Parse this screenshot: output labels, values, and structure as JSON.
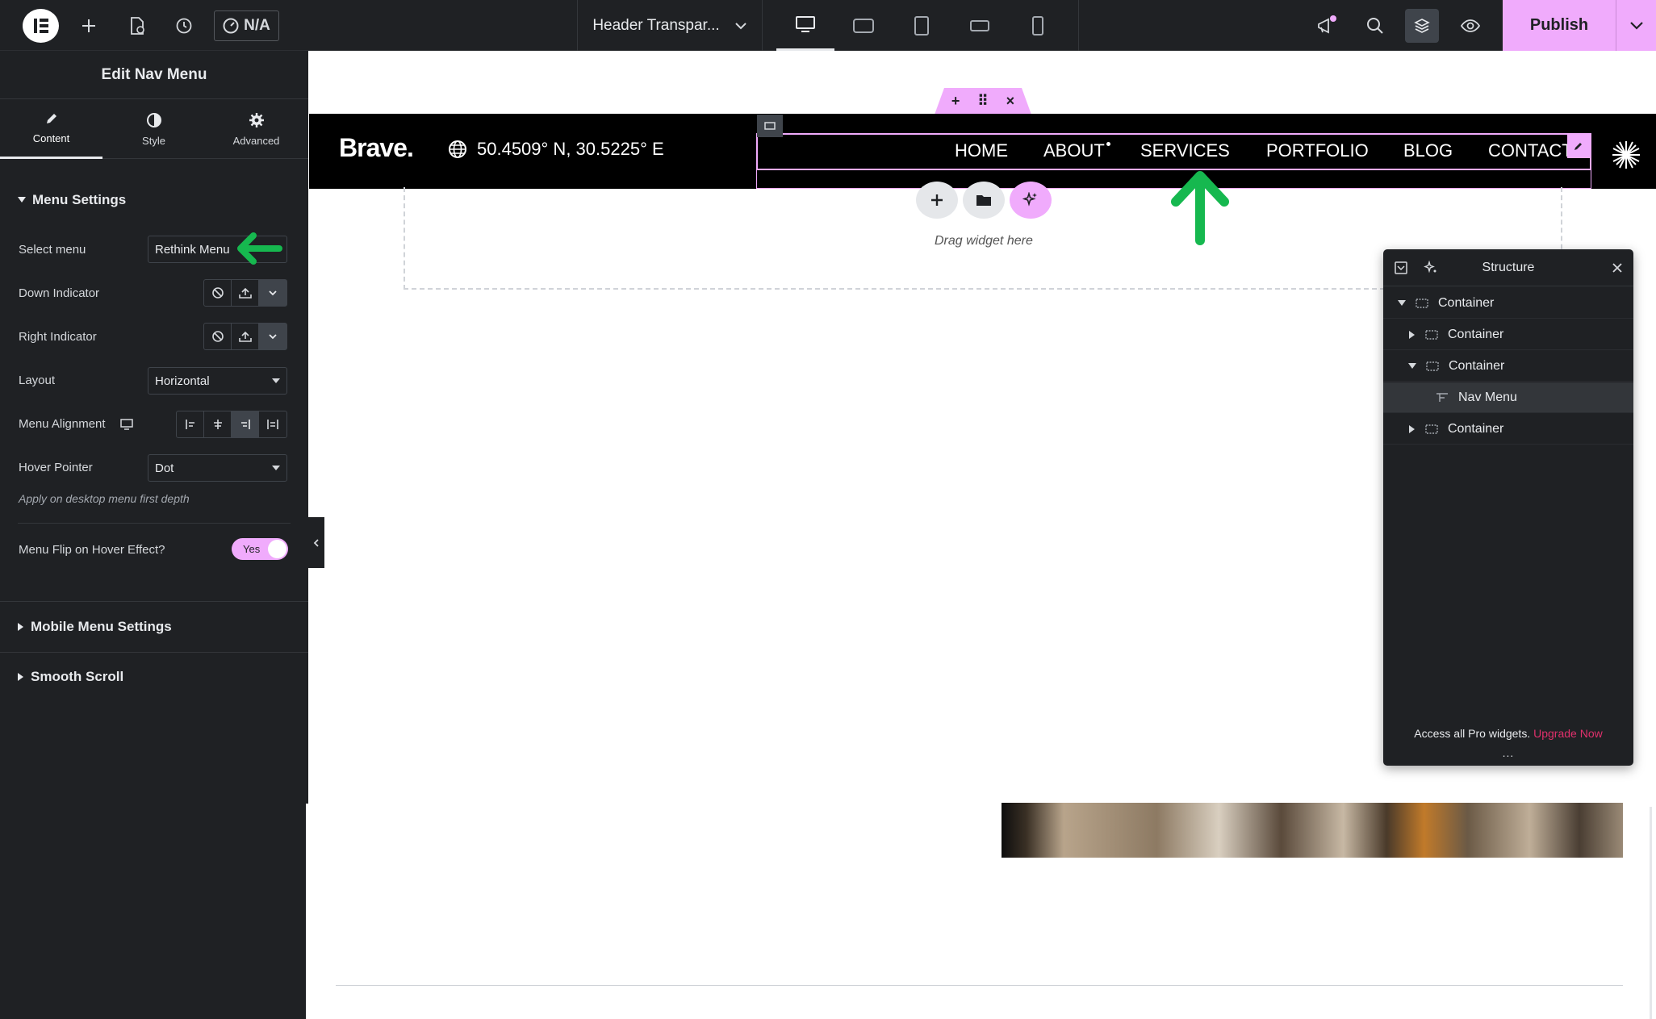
{
  "topbar": {
    "na_label": "N/A",
    "document_title": "Header Transpar...",
    "publish_label": "Publish"
  },
  "panel": {
    "title": "Edit Nav Menu",
    "tabs": [
      "Content",
      "Style",
      "Advanced"
    ],
    "menu_settings": {
      "heading": "Menu Settings",
      "select_menu_label": "Select menu",
      "select_menu_value": "Rethink Menu",
      "down_indicator_label": "Down Indicator",
      "right_indicator_label": "Right Indicator",
      "layout_label": "Layout",
      "layout_value": "Horizontal",
      "alignment_label": "Menu Alignment",
      "hover_pointer_label": "Hover Pointer",
      "hover_pointer_value": "Dot",
      "hint": "Apply on desktop menu first depth",
      "flip_label": "Menu Flip on Hover Effect?",
      "flip_value": "Yes"
    },
    "mobile_heading": "Mobile Menu Settings",
    "smooth_heading": "Smooth Scroll"
  },
  "canvas": {
    "brand": "Brave.",
    "coords": "50.4509° N, 30.5225° E",
    "nav_items": [
      "HOME",
      "ABOUT",
      "SERVICES",
      "PORTFOLIO",
      "BLOG",
      "CONTACT"
    ],
    "drop_text": "Drag widget here"
  },
  "structure": {
    "title": "Structure",
    "rows": [
      {
        "label": "Container"
      },
      {
        "label": "Container"
      },
      {
        "label": "Container"
      },
      {
        "label": "Nav Menu"
      },
      {
        "label": "Container"
      }
    ],
    "footer_text": "Access all Pro widgets.",
    "footer_link": "Upgrade Now",
    "footer_dots": "..."
  },
  "colors": {
    "panel_bg": "#1f2124",
    "accent_pink": "#f0abfc",
    "arrow_green": "#16b84f",
    "upgrade_link": "#e1306c"
  }
}
